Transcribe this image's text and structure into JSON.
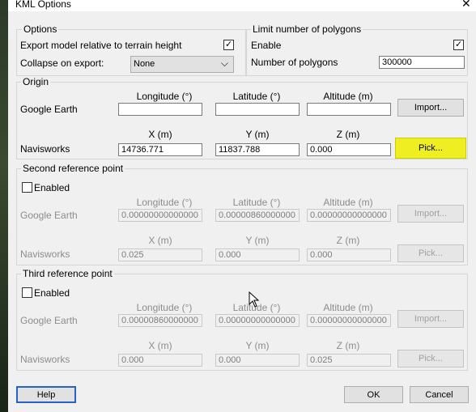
{
  "window": {
    "title": "KML Options",
    "close_glyph": "✕"
  },
  "options": {
    "title": "Options",
    "export_relative_label": "Export model relative to terrain height",
    "export_relative_checked": true,
    "collapse_label": "Collapse on export:",
    "collapse_value": "None"
  },
  "limit": {
    "title": "Limit number of polygons",
    "enable_label": "Enable",
    "enable_checked": true,
    "number_label": "Number of polygons",
    "number_value": "300000"
  },
  "origin": {
    "title": "Origin",
    "google_earth_label": "Google Earth",
    "longitude_header": "Longitude (°)",
    "latitude_header": "Latitude (°)",
    "altitude_header": "Altitude (m)",
    "ge_longitude": "",
    "ge_latitude": "",
    "ge_altitude": "",
    "import_label": "Import...",
    "navisworks_label": "Navisworks",
    "x_header": "X (m)",
    "y_header": "Y (m)",
    "z_header": "Z (m)",
    "nw_x": "14736.771",
    "nw_y": "11837.788",
    "nw_z": "0.000",
    "pick_label": "Pick..."
  },
  "second": {
    "title": "Second reference point",
    "enabled_label": "Enabled",
    "enabled_checked": false,
    "google_earth_label": "Google Earth",
    "longitude_header": "Longitude (°)",
    "latitude_header": "Latitude (°)",
    "altitude_header": "Altitude (m)",
    "ge_longitude": "0.00000000000000",
    "ge_latitude": "0.00000860000000",
    "ge_altitude": "0.00000000000000",
    "import_label": "Import...",
    "navisworks_label": "Navisworks",
    "x_header": "X (m)",
    "y_header": "Y (m)",
    "z_header": "Z (m)",
    "nw_x": "0.025",
    "nw_y": "0.000",
    "nw_z": "0.000",
    "pick_label": "Pick..."
  },
  "third": {
    "title": "Third reference point",
    "enabled_label": "Enabled",
    "enabled_checked": false,
    "google_earth_label": "Google Earth",
    "longitude_header": "Longitude (°)",
    "latitude_header": "Latitude (°)",
    "altitude_header": "Altitude (m)",
    "ge_longitude": "0.00000860000000",
    "ge_latitude": "0.00000000000000",
    "ge_altitude": "0.00000000000000",
    "import_label": "Import...",
    "navisworks_label": "Navisworks",
    "x_header": "X (m)",
    "y_header": "Y (m)",
    "z_header": "Z (m)",
    "nw_x": "0.000",
    "nw_y": "0.000",
    "nw_z": "0.025",
    "pick_label": "Pick..."
  },
  "footer": {
    "help_label": "Help",
    "ok_label": "OK",
    "cancel_label": "Cancel"
  },
  "colors": {
    "pick_highlight": "#eeee22",
    "focus_border": "#2a62c2"
  }
}
